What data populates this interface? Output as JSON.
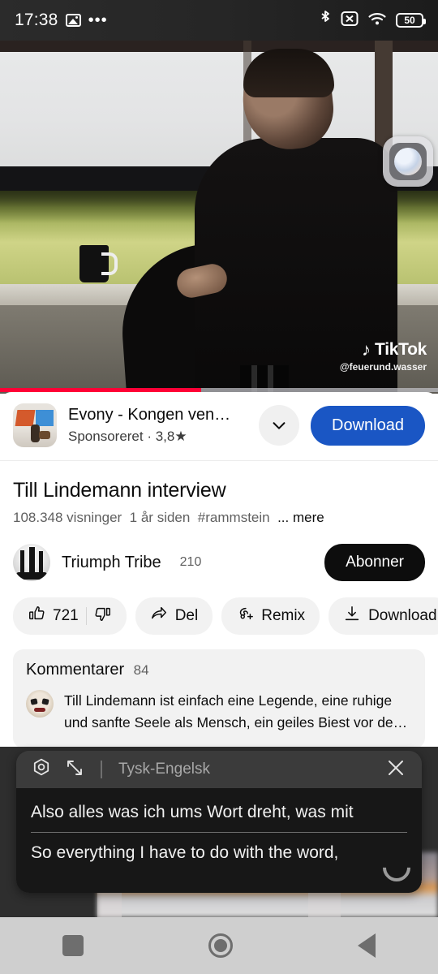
{
  "statusbar": {
    "time": "17:38",
    "photo_icon": "image-icon",
    "dots": "•••",
    "bluetooth_icon": "bluetooth-icon",
    "nosim_icon": "no-sim-icon",
    "wifi_icon": "wifi6-icon",
    "battery_level": "50"
  },
  "video": {
    "watermark_note": "♪",
    "watermark_brand": "TikTok",
    "watermark_handle": "@feuerund.wasser",
    "progress_percent": 46,
    "progress_color": "#ff0036",
    "floating_bubble": "assistant-bubble-icon"
  },
  "ad": {
    "title": "Evony - Kongen ven…",
    "subtitle": "Sponsoreret · 3,8★",
    "expand_icon": "chevron-down-icon",
    "cta_label": "Download",
    "cta_color": "#1a56c4"
  },
  "details": {
    "title": "Till Lindemann interview",
    "views": "108.348 visninger",
    "age": "1 år siden",
    "hashtag": "#rammstein",
    "more_label": "... mere"
  },
  "channel": {
    "name": "Triumph Tribe",
    "subscribers": "210",
    "subscribe_label": "Abonner",
    "avatar": "channel-avatar"
  },
  "actions": [
    {
      "name": "like",
      "label": "721",
      "icon": "thumbs-up-icon"
    },
    {
      "name": "dislike",
      "label": "",
      "icon": "thumbs-down-icon"
    },
    {
      "name": "share",
      "label": "Del",
      "icon": "share-arrow-icon"
    },
    {
      "name": "remix",
      "label": "Remix",
      "icon": "remix-icon"
    },
    {
      "name": "download",
      "label": "Download",
      "icon": "download-icon"
    }
  ],
  "comments": {
    "header": "Kommentarer",
    "count": "84",
    "top_comment": "Till Lindemann ist einfach eine Legende, eine ruhige und sanfte Seele als Mensch,  ein geiles Biest vor de…",
    "avatar": "clown-avatar"
  },
  "caption_overlay": {
    "settings_icon": "hex-gear-icon",
    "expand_icon": "expand-diagonal-icon",
    "language": "Tysk-Engelsk",
    "close_icon": "close-icon",
    "source_line": "Also alles was ich ums Wort dreht, was mit",
    "translated_line": "So everything I have to do with the word,",
    "resize_handle": "resize-arc-handle"
  },
  "navbar": {
    "recents": "recents-square-icon",
    "home": "home-circle-icon",
    "back": "back-triangle-icon"
  }
}
